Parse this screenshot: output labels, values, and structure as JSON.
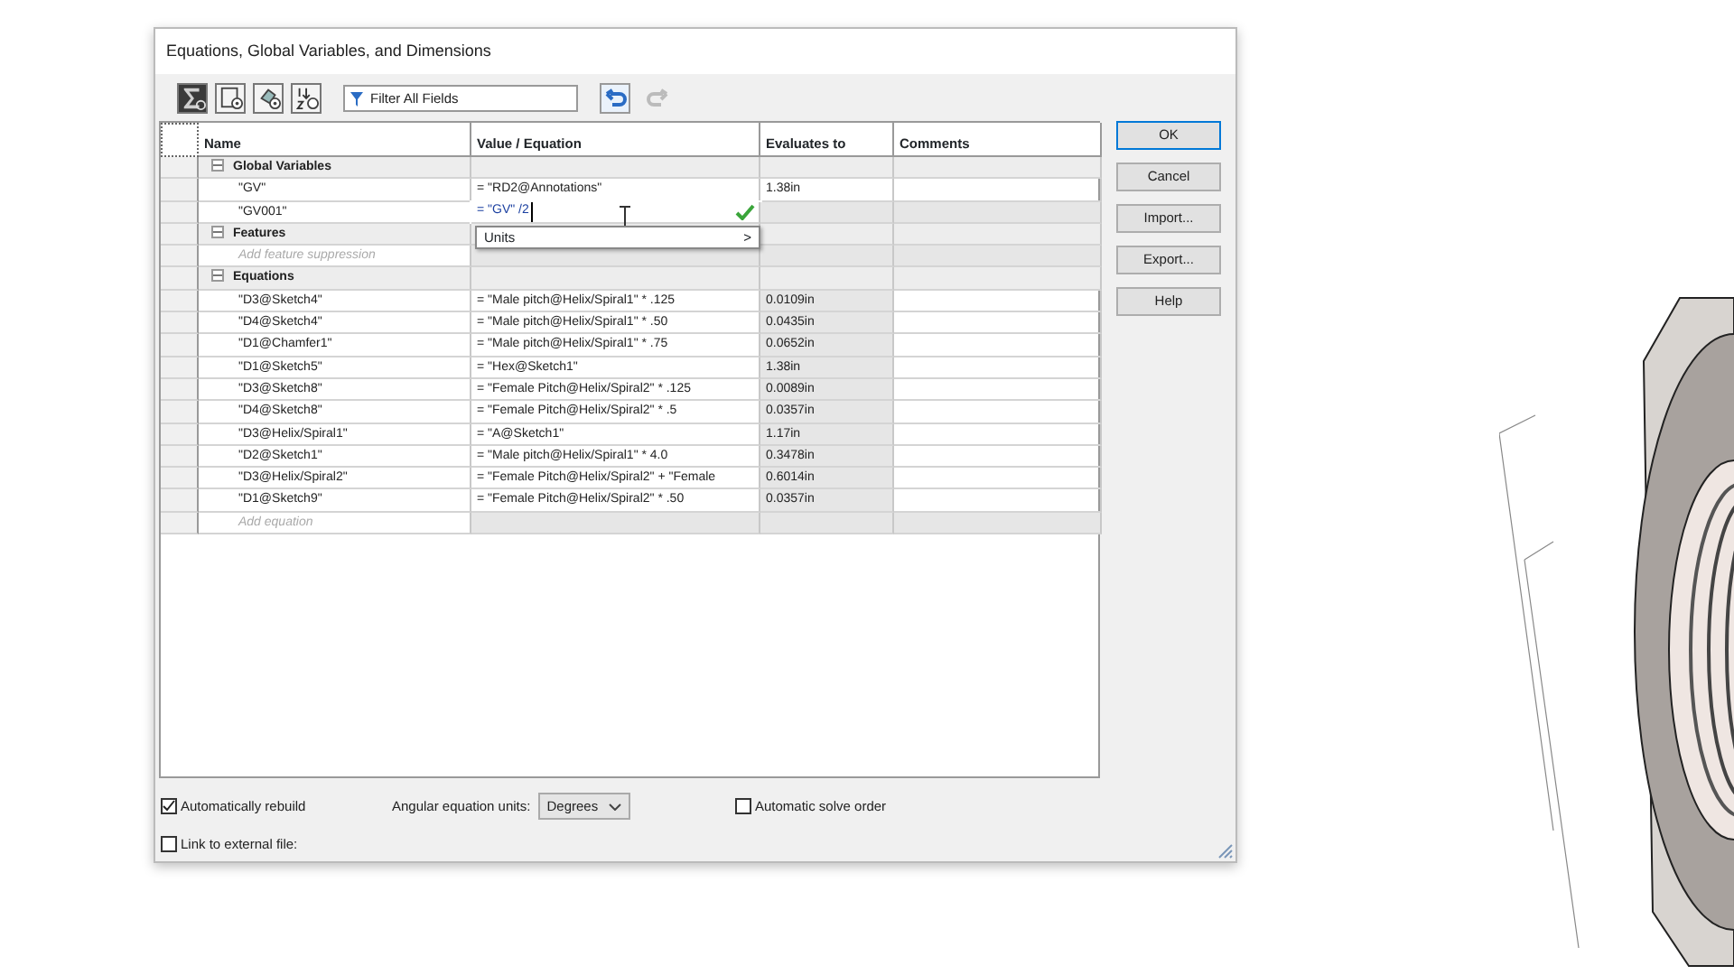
{
  "window": {
    "title": "Equations, Global Variables, and Dimensions"
  },
  "toolbar": {
    "view_buttons": [
      {
        "kind": "equations",
        "selected": true
      },
      {
        "kind": "sketch",
        "selected": false
      },
      {
        "kind": "features",
        "selected": false
      },
      {
        "kind": "ordered",
        "selected": false
      }
    ],
    "filter": {
      "placeholder": "Filter All Fields"
    },
    "undo": {
      "disabled": false
    },
    "redo": {
      "disabled": true
    }
  },
  "table": {
    "columns": [
      "Name",
      "Value / Equation",
      "Evaluates to",
      "Comments"
    ],
    "rows": [
      {
        "kind": "group",
        "name": "Global Variables",
        "expanded": true
      },
      {
        "kind": "item",
        "name": "\"GV\"",
        "value": "= \"RD2@Annotations\"",
        "evaluates": "1.38in"
      },
      {
        "kind": "editing",
        "name": "\"GV001\"",
        "value": "= \"GV\" /2"
      },
      {
        "kind": "group",
        "name": "Features",
        "expanded": true
      },
      {
        "kind": "add",
        "name": "Add feature suppression"
      },
      {
        "kind": "group",
        "name": "Equations",
        "expanded": true
      },
      {
        "kind": "item",
        "name": "\"D3@Sketch4\"",
        "value": "= \"Male pitch@Helix/Spiral1\" * .125",
        "evaluates": "0.0109in"
      },
      {
        "kind": "item",
        "name": "\"D4@Sketch4\"",
        "value": "= \"Male pitch@Helix/Spiral1\" * .50",
        "evaluates": "0.0435in"
      },
      {
        "kind": "item",
        "name": "\"D1@Chamfer1\"",
        "value": "= \"Male pitch@Helix/Spiral1\" * .75",
        "evaluates": "0.0652in"
      },
      {
        "kind": "item",
        "name": "\"D1@Sketch5\"",
        "value": "= \"Hex@Sketch1\"",
        "evaluates": "1.38in"
      },
      {
        "kind": "item",
        "name": "\"D3@Sketch8\"",
        "value": "= \"Female Pitch@Helix/Spiral2\" * .125",
        "evaluates": "0.0089in"
      },
      {
        "kind": "item",
        "name": "\"D4@Sketch8\"",
        "value": "= \"Female Pitch@Helix/Spiral2\" * .5",
        "evaluates": "0.0357in"
      },
      {
        "kind": "item",
        "name": "\"D3@Helix/Spiral1\"",
        "value": "= \"A@Sketch1\"",
        "evaluates": "1.17in"
      },
      {
        "kind": "item",
        "name": "\"D2@Sketch1\"",
        "value": "= \"Male pitch@Helix/Spiral1\" * 4.0",
        "evaluates": "0.3478in"
      },
      {
        "kind": "item",
        "name": "\"D3@Helix/Spiral2\"",
        "value": "= \"Female Pitch@Helix/Spiral2\" + \"Female",
        "evaluates": "0.6014in"
      },
      {
        "kind": "item",
        "name": "\"D1@Sketch9\"",
        "value": "= \"Female Pitch@Helix/Spiral2\" * .50",
        "evaluates": "0.0357in"
      },
      {
        "kind": "add",
        "name": "Add equation"
      }
    ]
  },
  "autocomplete": {
    "items": [
      {
        "label": "Units",
        "arrow": ">"
      }
    ]
  },
  "buttons": [
    {
      "label": "OK",
      "default": true
    },
    {
      "label": "Cancel",
      "default": false
    },
    {
      "label": "Import...",
      "default": false
    },
    {
      "label": "Export...",
      "default": false
    },
    {
      "label": "Help",
      "default": false
    }
  ],
  "options": {
    "auto_rebuild": {
      "label": "Automatically rebuild",
      "checked": true
    },
    "angular_units": {
      "label": "Angular equation units:",
      "value": "Degrees"
    },
    "auto_solve": {
      "label": "Automatic solve order",
      "checked": false
    },
    "link_external": {
      "label": "Link to external file:",
      "checked": false
    }
  }
}
